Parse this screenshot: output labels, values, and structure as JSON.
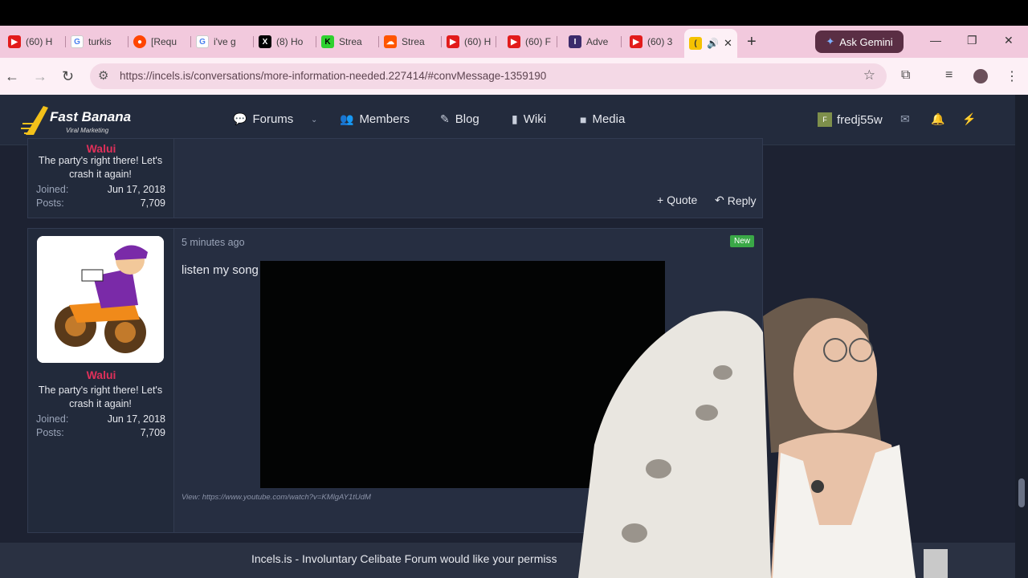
{
  "browser": {
    "tabs": [
      {
        "label": "(60) H",
        "icon": "youtube-icon",
        "color": "#e21b1b"
      },
      {
        "label": "turkis",
        "icon": "google-icon",
        "color": "#4a80f0"
      },
      {
        "label": "[Requ",
        "icon": "reddit-icon",
        "color": "#ff4500"
      },
      {
        "label": "i've g",
        "icon": "google-icon",
        "color": "#4a80f0"
      },
      {
        "label": "(8) Ho",
        "icon": "x-icon",
        "color": "#000000"
      },
      {
        "label": "Strea",
        "icon": "kick-icon",
        "color": "#2fd12f"
      },
      {
        "label": "Strea",
        "icon": "soundcloud-icon",
        "color": "#ff5500"
      },
      {
        "label": "(60) H",
        "icon": "youtube-icon",
        "color": "#e21b1b"
      },
      {
        "label": "(60) F",
        "icon": "youtube-icon",
        "color": "#e21b1b"
      },
      {
        "label": "Adve",
        "icon": "forum-icon",
        "color": "#3b2b6b"
      },
      {
        "label": "(60) 3",
        "icon": "youtube-icon",
        "color": "#e21b1b"
      }
    ],
    "gemini_label": "Ask Gemini",
    "url": "https://incels.is/conversations/more-information-needed.227414/#convMessage-1359190"
  },
  "site": {
    "logo_brand": "Fast Banana",
    "logo_sub": "Viral Marketing",
    "nav": [
      {
        "label": "Forums",
        "icon": "comments-icon"
      },
      {
        "label": "Members",
        "icon": "users-icon"
      },
      {
        "label": "Blog",
        "icon": "blog-icon"
      },
      {
        "label": "Wiki",
        "icon": "book-icon"
      },
      {
        "label": "Media",
        "icon": "video-camera-icon"
      }
    ],
    "username": "fredj55w",
    "user_initial": "F"
  },
  "post1": {
    "author": "Walui",
    "user_title": "The party's right there! Let's crash it again!",
    "joined_label": "Joined:",
    "joined_value": "Jun 17, 2018",
    "posts_label": "Posts:",
    "posts_value": "7,709",
    "quote_label": "Quote",
    "reply_label": "Reply"
  },
  "post2": {
    "time": "5 minutes ago",
    "badge": "New",
    "author": "Walui",
    "user_title": "The party's right there! Let's crash it again!",
    "joined_label": "Joined:",
    "joined_value": "Jun 17, 2018",
    "posts_label": "Posts:",
    "posts_value": "7,709",
    "message": "listen my song",
    "view_link": "View: https://www.youtube.com/watch?v=KMlgAY1tUdM"
  },
  "cookie_text": "Incels.is - Involuntary Celibate Forum would like your permiss"
}
